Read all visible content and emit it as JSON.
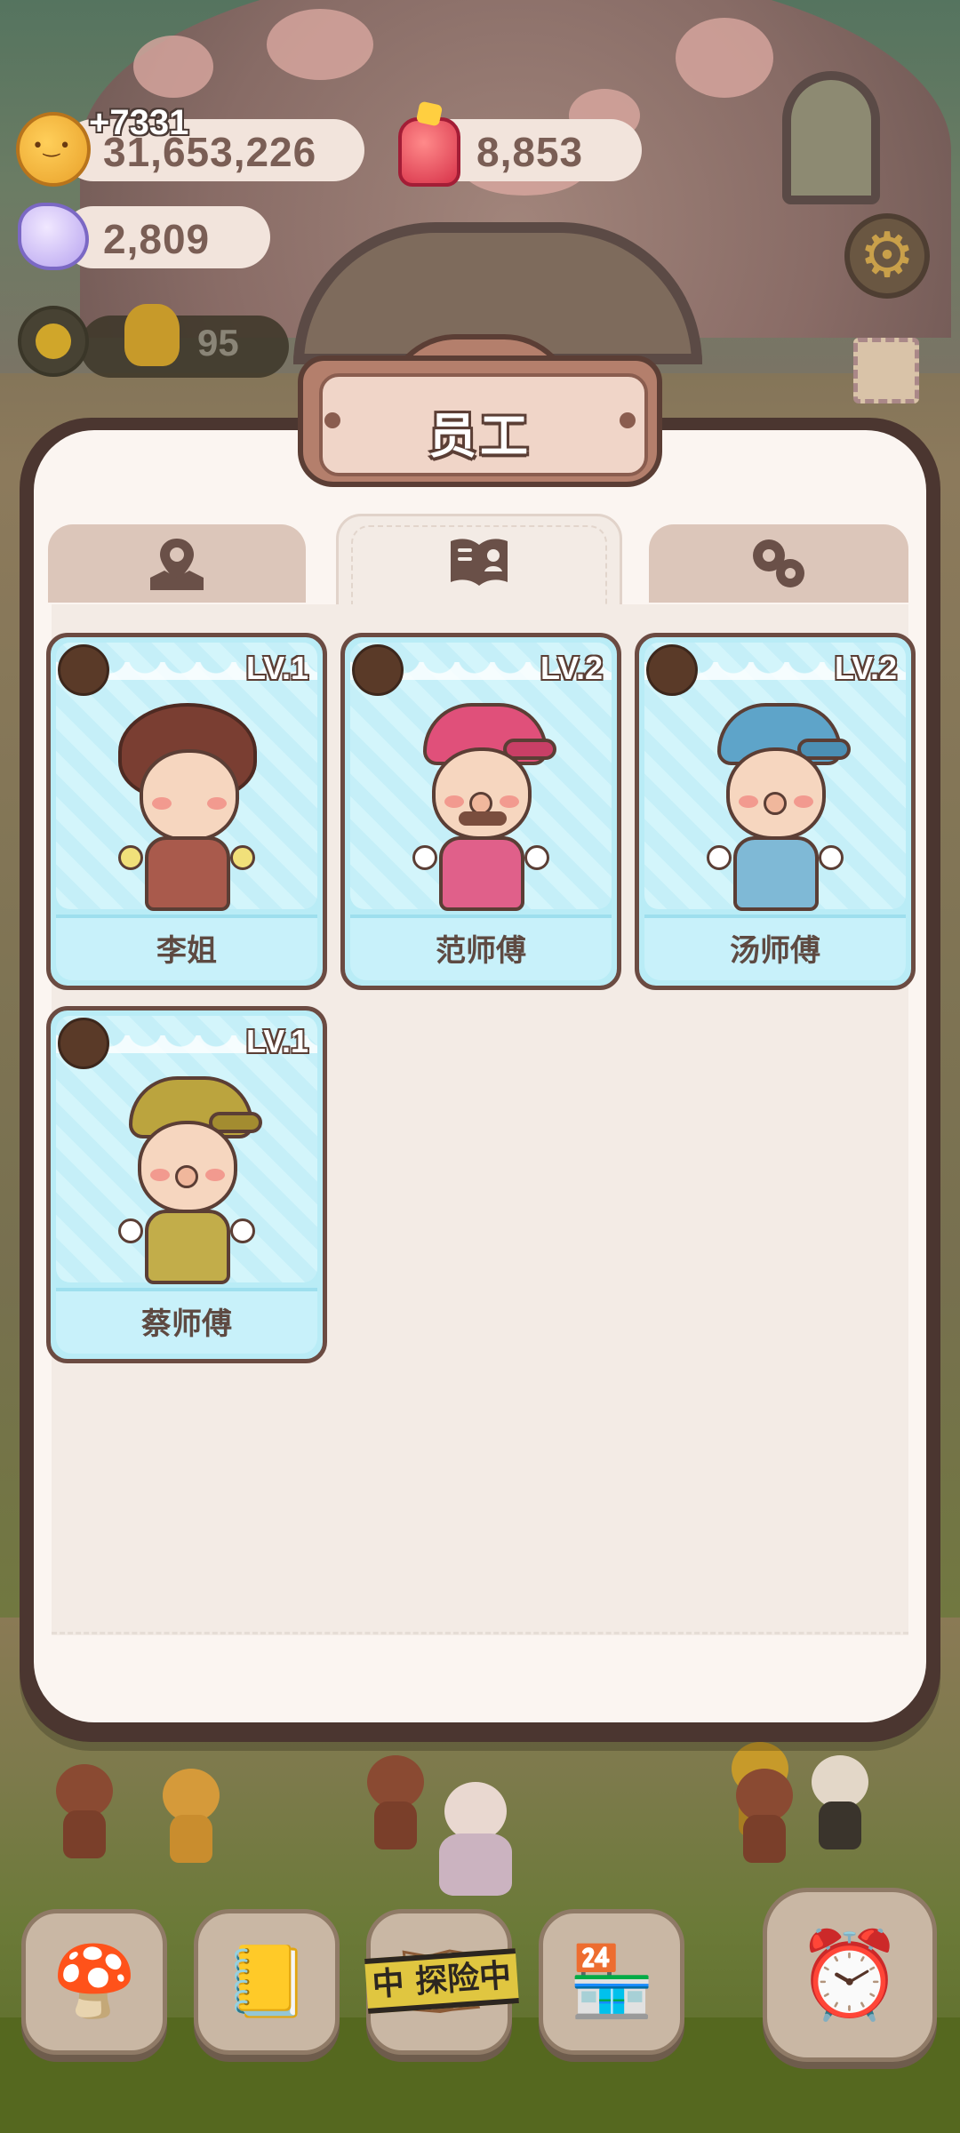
{
  "hud": {
    "coins": "31,653,226",
    "coins_gain": "+7331",
    "jelly": "8,853",
    "crystals": "2,809",
    "energy": "95"
  },
  "dialog": {
    "title": "员工",
    "tabs": [
      {
        "icon": "map-pin-icon",
        "active": false
      },
      {
        "icon": "book-icon",
        "active": true
      },
      {
        "icon": "gears-icon",
        "active": false
      }
    ]
  },
  "staff": [
    {
      "name": "李姐",
      "level": "LV.1",
      "accent": "#c9584f"
    },
    {
      "name": "范师傅",
      "level": "LV.2",
      "accent": "#e0507a"
    },
    {
      "name": "汤师傅",
      "level": "LV.2",
      "accent": "#5ea4c9"
    },
    {
      "name": "蔡师傅",
      "level": "LV.1",
      "accent": "#bba43e"
    }
  ],
  "nav": {
    "adventure_tape": "中 探险中",
    "items": [
      "house-icon",
      "notebook-icon",
      "expedition-icon",
      "shop-icon",
      "timer-icon"
    ]
  },
  "colors": {
    "frame": "#4b3630",
    "panel": "#f3ebe5",
    "card": "#b9ecf6",
    "title_plate": "#b47f6c"
  }
}
